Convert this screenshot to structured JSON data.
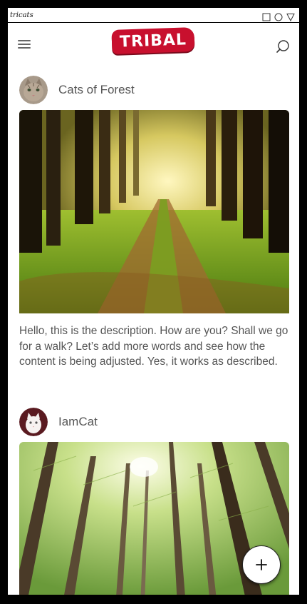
{
  "window": {
    "title": "tricats"
  },
  "header": {
    "logo_text": "TRIBAL"
  },
  "colors": {
    "logo_red": "#c8102e",
    "text_gray": "#555555"
  },
  "icons": {
    "menu": "hamburger-menu-icon",
    "search": "search-icon",
    "add": "plus-icon",
    "window_square": "square-icon",
    "window_circle": "circle-icon",
    "window_triangle": "triangle-icon"
  },
  "posts": [
    {
      "author": "Cats of Forest",
      "description": "Hello, this is the description. How are you? Shall we go for a walk? Let’s add more words and see how the content is being adjusted. Yes, it works as described."
    },
    {
      "author": "IamCat",
      "description": ""
    }
  ]
}
